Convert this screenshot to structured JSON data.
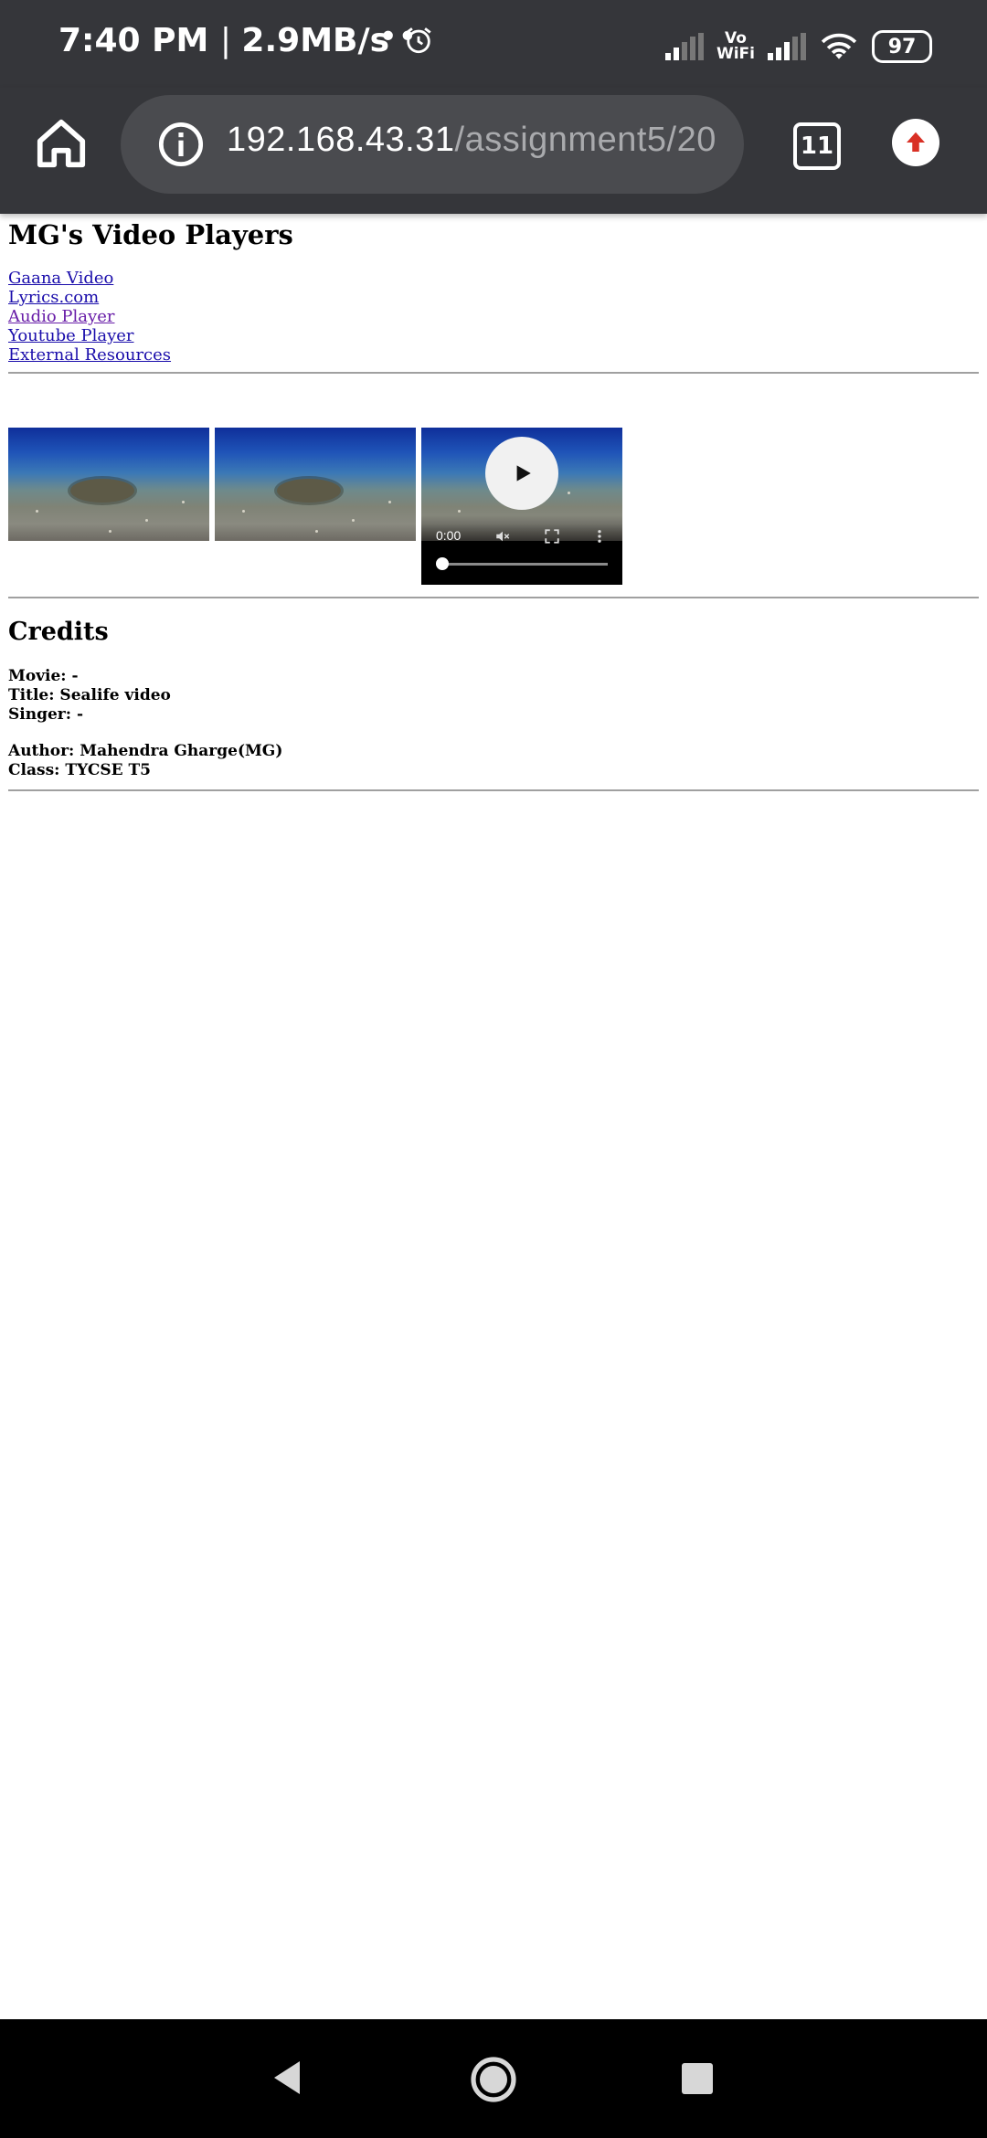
{
  "status_bar": {
    "time": "7:40 PM",
    "speed": "2.9MB/s",
    "dots": "••",
    "vowifi_top": "Vo",
    "vowifi_bottom": "WiFi",
    "battery": "97"
  },
  "browser": {
    "url_host": "192.168.43.31",
    "url_path": "/assignment5/20",
    "tab_count": "11"
  },
  "page": {
    "title": "MG's Video Players",
    "nav_links": [
      {
        "label": "Gaana Video"
      },
      {
        "label": "Lyrics.com"
      },
      {
        "label": "Audio Player"
      },
      {
        "label": "Youtube Player"
      },
      {
        "label": "External Resources"
      }
    ],
    "player": {
      "current_time": "0:00"
    },
    "credits": {
      "heading": "Credits",
      "movie": "Movie: -",
      "title": "Title: Sealife video",
      "singer": "Singer: -",
      "author": "Author: Mahendra Gharge(MG)",
      "class": "Class: TYCSE T5"
    }
  }
}
